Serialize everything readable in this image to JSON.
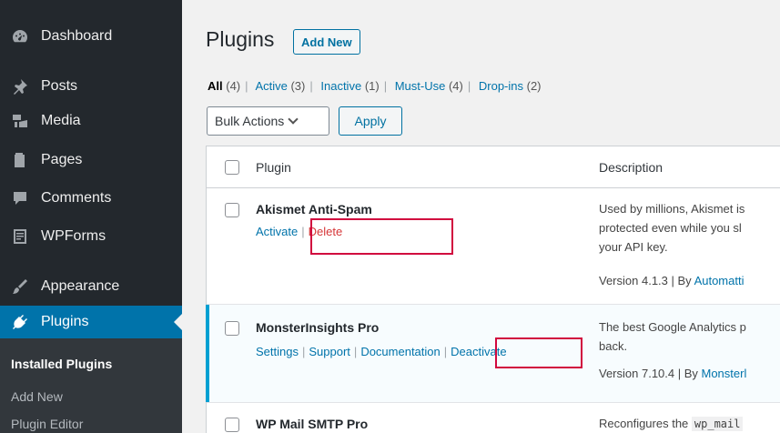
{
  "sidebar": {
    "items": [
      {
        "label": "Dashboard",
        "icon": "dashboard-icon"
      },
      {
        "label": "Posts",
        "icon": "pin-icon"
      },
      {
        "label": "Media",
        "icon": "media-icon"
      },
      {
        "label": "Pages",
        "icon": "pages-icon"
      },
      {
        "label": "Comments",
        "icon": "comment-icon"
      },
      {
        "label": "WPForms",
        "icon": "forms-icon"
      },
      {
        "label": "Appearance",
        "icon": "brush-icon"
      },
      {
        "label": "Plugins",
        "icon": "plugin-icon"
      }
    ],
    "submenu": [
      "Installed Plugins",
      "Add New",
      "Plugin Editor"
    ]
  },
  "page": {
    "title": "Plugins",
    "add_new": "Add New"
  },
  "filters": {
    "all": "All",
    "all_count": "(4)",
    "active": "Active",
    "active_count": "(3)",
    "inactive": "Inactive",
    "inactive_count": "(1)",
    "mustuse": "Must-Use",
    "mustuse_count": "(4)",
    "dropins": "Drop-ins",
    "dropins_count": "(2)",
    "separator": "|"
  },
  "bulk": {
    "select_label": "Bulk Actions",
    "apply": "Apply"
  },
  "table": {
    "col_plugin": "Plugin",
    "col_description": "Description",
    "rows": [
      {
        "name": "Akismet Anti-Spam",
        "actions": [
          "Activate",
          "Delete"
        ],
        "desc_lines": [
          "Used by millions, Akismet is",
          "protected even while you sl",
          "your API key."
        ],
        "version": "Version 4.1.3 | By ",
        "author": "Automatti"
      },
      {
        "name": "MonsterInsights Pro",
        "actions": [
          "Settings",
          "Support",
          "Documentation",
          "Deactivate"
        ],
        "desc_lines": [
          "The best Google Analytics p",
          "back."
        ],
        "version": "Version 7.10.4 | By ",
        "author": "Monsterl"
      },
      {
        "name": "WP Mail SMTP Pro",
        "desc_prefix": "Reconfigures the ",
        "desc_code": "wp_mail"
      }
    ],
    "action_sep": "|"
  },
  "colors": {
    "sidebar_bg": "#23282d",
    "accent": "#0073aa",
    "highlight_box": "#d1073e",
    "delete": "#d63638"
  }
}
